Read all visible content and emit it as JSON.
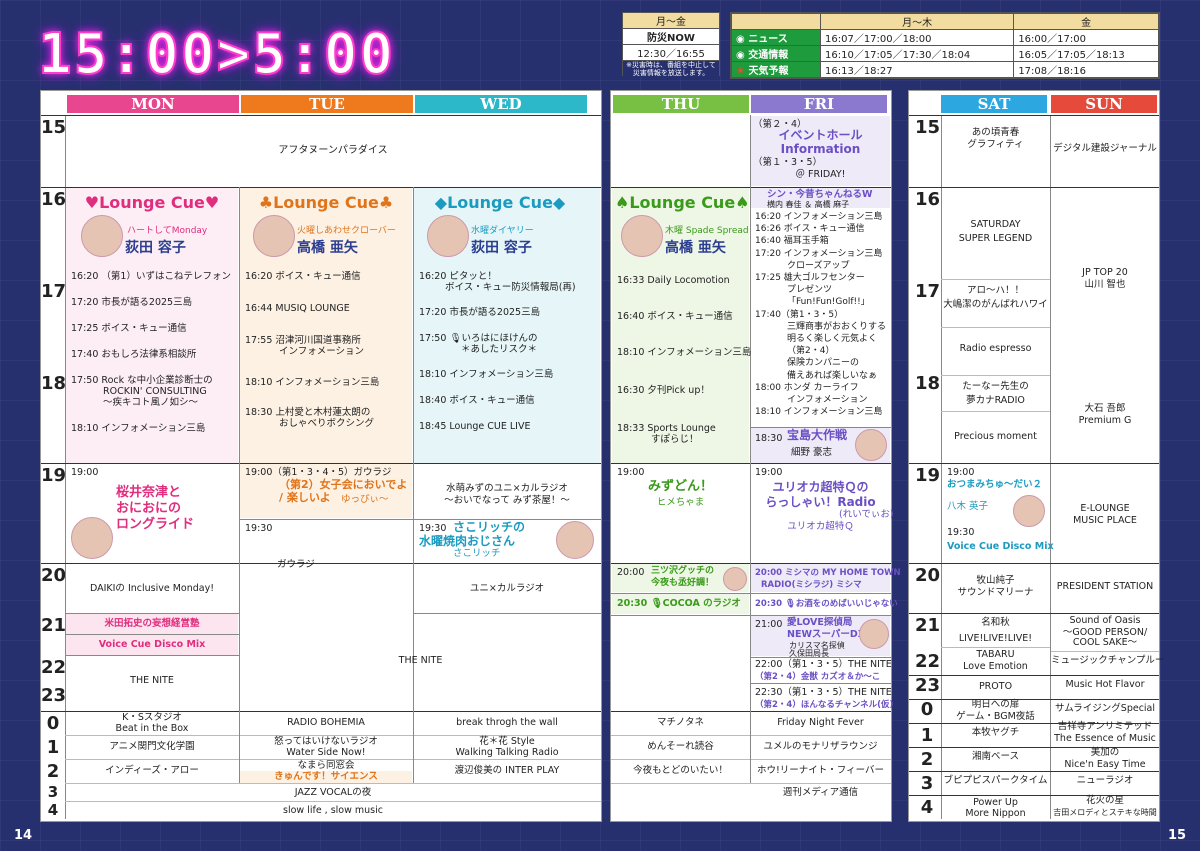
{
  "title": "15:00>5:00",
  "info_left": {
    "header": "月〜金",
    "name": "防災NOW",
    "time": "12:30／16:55",
    "note1": "※災害時は、番組を中止して",
    "note2": "災害情報を放送します。"
  },
  "info_right": {
    "h_mon_thu": "月〜木",
    "h_fri": "金",
    "rows": [
      {
        "label": "ニュース",
        "mt": "16:07／17:00／18:00",
        "fri": "16:00／17:00"
      },
      {
        "label": "交通情報",
        "mt": "16:10／17:05／17:30／18:04",
        "fri": "16:05／17:05／18:13"
      },
      {
        "label": "天気予報",
        "mt": "16:13／18:27",
        "fri": "17:08／18:16"
      }
    ]
  },
  "days": {
    "mon": "MON",
    "tue": "TUE",
    "wed": "WED",
    "thu": "THU",
    "fri": "FRI",
    "sat": "SAT",
    "sun": "SUN"
  },
  "hours": [
    "15",
    "16",
    "17",
    "18",
    "19",
    "20",
    "21",
    "22",
    "23",
    "0",
    "1",
    "2",
    "3",
    "4"
  ],
  "weekday": {
    "afternoon": "アフタヌーンパラダイス",
    "mon": {
      "lc": "♥Lounge Cue♥",
      "sub": "ハートしてMonday",
      "host": "荻田 容子",
      "items": [
        "16:20 （第1）いずはこねテレフォン",
        "17:20 市長が語る2025三島",
        "17:25 ボイス・キュー通信",
        "17:40 おもしろ法律系相談所",
        "17:50 Rock な中小企業診断士の",
        "ROCKIN' CONSULTING",
        "〜疾キコト風ノ如シ〜",
        "18:10 インフォメーション三島"
      ],
      "t19": "19:00",
      "p19a": "桜井奈津と",
      "p19b": "おにおにの",
      "p19c": "ロングライド",
      "p20": "DAIKIの Inclusive Monday!",
      "p21a": "米田拓史の妄想経営塾",
      "p21b": "Voice Cue Disco Mix"
    },
    "tue": {
      "lc": "♣Lounge Cue♣",
      "sub": "火曜しあわせクローバー",
      "host": "高橋 亜矢",
      "items": [
        "16:20 ボイス・キュー通信",
        "16:44 MUSIQ LOUNGE",
        "17:55 沼津河川国道事務所",
        "インフォメーション",
        "18:10 インフォメーション三島",
        "18:30 上村愛と木村蓮太朗の",
        "おしゃべりボクシング"
      ],
      "p19": "19:00（第1・3・4・5）ガウラジ",
      "p19b": "（第2）女子会においでよ",
      "p19c": "/ 楽しいよ",
      "p19d": "ゆっぴぃ〜",
      "t1930": "19:30",
      "p1930": "ガウラジ"
    },
    "wed": {
      "lc": "◆Lounge Cue◆",
      "sub": "水曜ダイヤリー",
      "host": "荻田 容子",
      "items": [
        "16:20 ピタッと！",
        "ボイス・キュー防災情報局(再)",
        "17:20 市長が語る2025三島",
        "17:50 🎙いろはにほけんの",
        "＊あしたリスク＊",
        "18:10 インフォメーション三島",
        "18:40 ボイス・キュー通信",
        "18:45 Lounge CUE LIVE"
      ],
      "p19a": "水萌みずのユニ×カルラジオ",
      "p19b": "〜おいでなって みず茶屋！〜",
      "t1930": "19:30",
      "p1930a": "さこリッチの",
      "p1930b": "水曜焼肉おじさん",
      "p1930c": "さこリッチ",
      "p20": "ユニ×カルラジオ"
    },
    "thu": {
      "lc": "♠Lounge Cue♠",
      "sub": "木曜 Spade Spread",
      "host": "高橋 亜矢",
      "items": [
        "16:33 Daily Locomotion",
        "16:40 ボイス・キュー通信",
        "18:10 インフォメーション三島",
        "16:30 夕刊Pick up！",
        "18:33 Sports Lounge",
        "すぽらじ！"
      ],
      "t19": "19:00",
      "p19a": "みずどん！",
      "p19b": "ヒメちゃま",
      "p20a": "20:00",
      "p20b": "三ツ沢グッチの",
      "p20c": "今夜も丞好調！",
      "p2030": "20:30 🎙COCOA のラジオ"
    },
    "fri": {
      "p15a": "（第２・4）",
      "p15b": "イベントホール",
      "p15c": "Information",
      "p15d": "（第１・3・5）",
      "p15e": "＠ FRIDAY!",
      "s16a": "シン・今昔ちゃんねるW",
      "s16b": "横内 春佳 ＆ 高橋 麻子",
      "items": [
        "16:20 インフォメーション三島",
        "16:26 ボイス・キュー通信",
        "16:40 福耳玉手箱",
        "17:20 インフォメーション三島",
        "クローズアップ",
        "17:25 雄大ゴルフセンター",
        "プレゼンツ",
        "「Fun!Fun!Golf!!」",
        "17:40（第1・3・5）",
        "三輝商事がおおくりする",
        "明るく楽しく元気よく",
        "（第2・4）",
        "保険カンパニーの",
        "備えあれば楽しいなぁ",
        "18:00 ホンダ カーライフ",
        "インフォメーション",
        "18:10 インフォメーション三島"
      ],
      "s1830a": "18:30",
      "s1830b": "宝島大作戦",
      "s1830c": "細野 豪志",
      "t19": "19:00",
      "p19a": "ユリオカ超特Ｑの",
      "p19b": "らっしゃい！Radio",
      "p19c": "(れいでぃお)",
      "p19d": "ユリオカ超特Ｑ",
      "p20": "20:00 ミシマの MY HOME TOWN",
      "p20b": "RADIO(ミシラジ) ミシマ",
      "p2030": "20:30 🎙お酒をのめばいいじゃない",
      "p21a": "21:00",
      "p21b": "愛LOVE探偵局",
      "p21c": "NEWスーパーDX",
      "p21d": "カリスマ名探偵",
      "p21e": "久保田局長",
      "p22a": "22:00（第1・3・5）THE NITE",
      "p22b": "（第2・4）金獣 カズオ＆か〜こ",
      "p2230a": "22:30（第1・3・5）THE NITE",
      "p2230b": "（第2・4）ほんなるチャンネル(仮)"
    },
    "nite": "THE NITE",
    "nite_mon": "THE NITE",
    "late": {
      "mon0a": "K・Sスタジオ",
      "mon0b": "Beat in the Box",
      "mon1": "アニメ関門文化学園",
      "mon2": "インディーズ・アロー",
      "tue0": "RADIO BOHEMIA",
      "tue1a": "怒ってはいけないラジオ",
      "tue1b": "Water Side Now!",
      "tue2a": "なまら同窓会",
      "tue2b": "きゅんです！サイエンス",
      "wed0": "break throgh the wall",
      "wed1a": "花＊花 Style",
      "wed1b": "Walking Talking Radio",
      "wed2": "渡辺俊美の INTER PLAY",
      "thu0": "マチノタネ",
      "thu1": "めんそーれ読谷",
      "thu2": "今夜もとどのいたい！",
      "fri0": "Friday Night Fever",
      "fri1": "ユメルのモナリザラウンジ",
      "fri2": "ホウ!リーナイト・フィーバー",
      "fri3": "週刊メディア通信",
      "jazz": "JAZZ VOCALの夜",
      "slow": "slow life , slow music"
    }
  },
  "weekend": {
    "sat": [
      "あの頃青春",
      "グラフィティ",
      "SATURDAY",
      "SUPER LEGEND",
      "アロ〜ハ！！",
      "大嶋潔のがんばれハワイ",
      "Radio espresso",
      "たーなー先生の",
      "夢カナRADIO",
      "Precious moment",
      "19:00",
      "おつまみちゅ〜だい２",
      "八木 英子",
      "19:30",
      "Voice Cue Disco Mix",
      "牧山純子",
      "サウンドマリーナ",
      "名和秋",
      "LIVE!LIVE!LIVE!",
      "TABARU",
      "Love Emotion",
      "PROTO",
      "明日への扉",
      "ゲーム・BGM夜話",
      "本牧ヤグチ",
      "湘南ベース",
      "ブピプピスパークタイム",
      "Power Up",
      "More Nippon"
    ],
    "sun": [
      "デジタル建設ジャーナル",
      "JP TOP 20",
      "山川 智也",
      "大石 吾郎",
      "Premium G",
      "E-LOUNGE",
      "MUSIC PLACE",
      "PRESIDENT STATION",
      "Sound of Oasis",
      "〜GOOD PERSON/",
      "COOL SAKE〜",
      "ミュージックチャンプルー",
      "Music Hot Flavor",
      "サムライジングSpecial",
      "吉祥寺アンリミテッド",
      "The Essence of Music",
      "美加の",
      "Nice'n Easy Time",
      "ニューラジオ",
      "花火の星",
      "吉田メロディとステキな時間"
    ]
  },
  "page_left": "14",
  "page_right": "15",
  "colors": {
    "mon": "#e8468f",
    "tue": "#ee7a1d",
    "wed": "#2cb8c8",
    "thu": "#77c043",
    "fri": "#8b79d0",
    "sat": "#2ca7e0",
    "sun": "#e64a3a"
  }
}
